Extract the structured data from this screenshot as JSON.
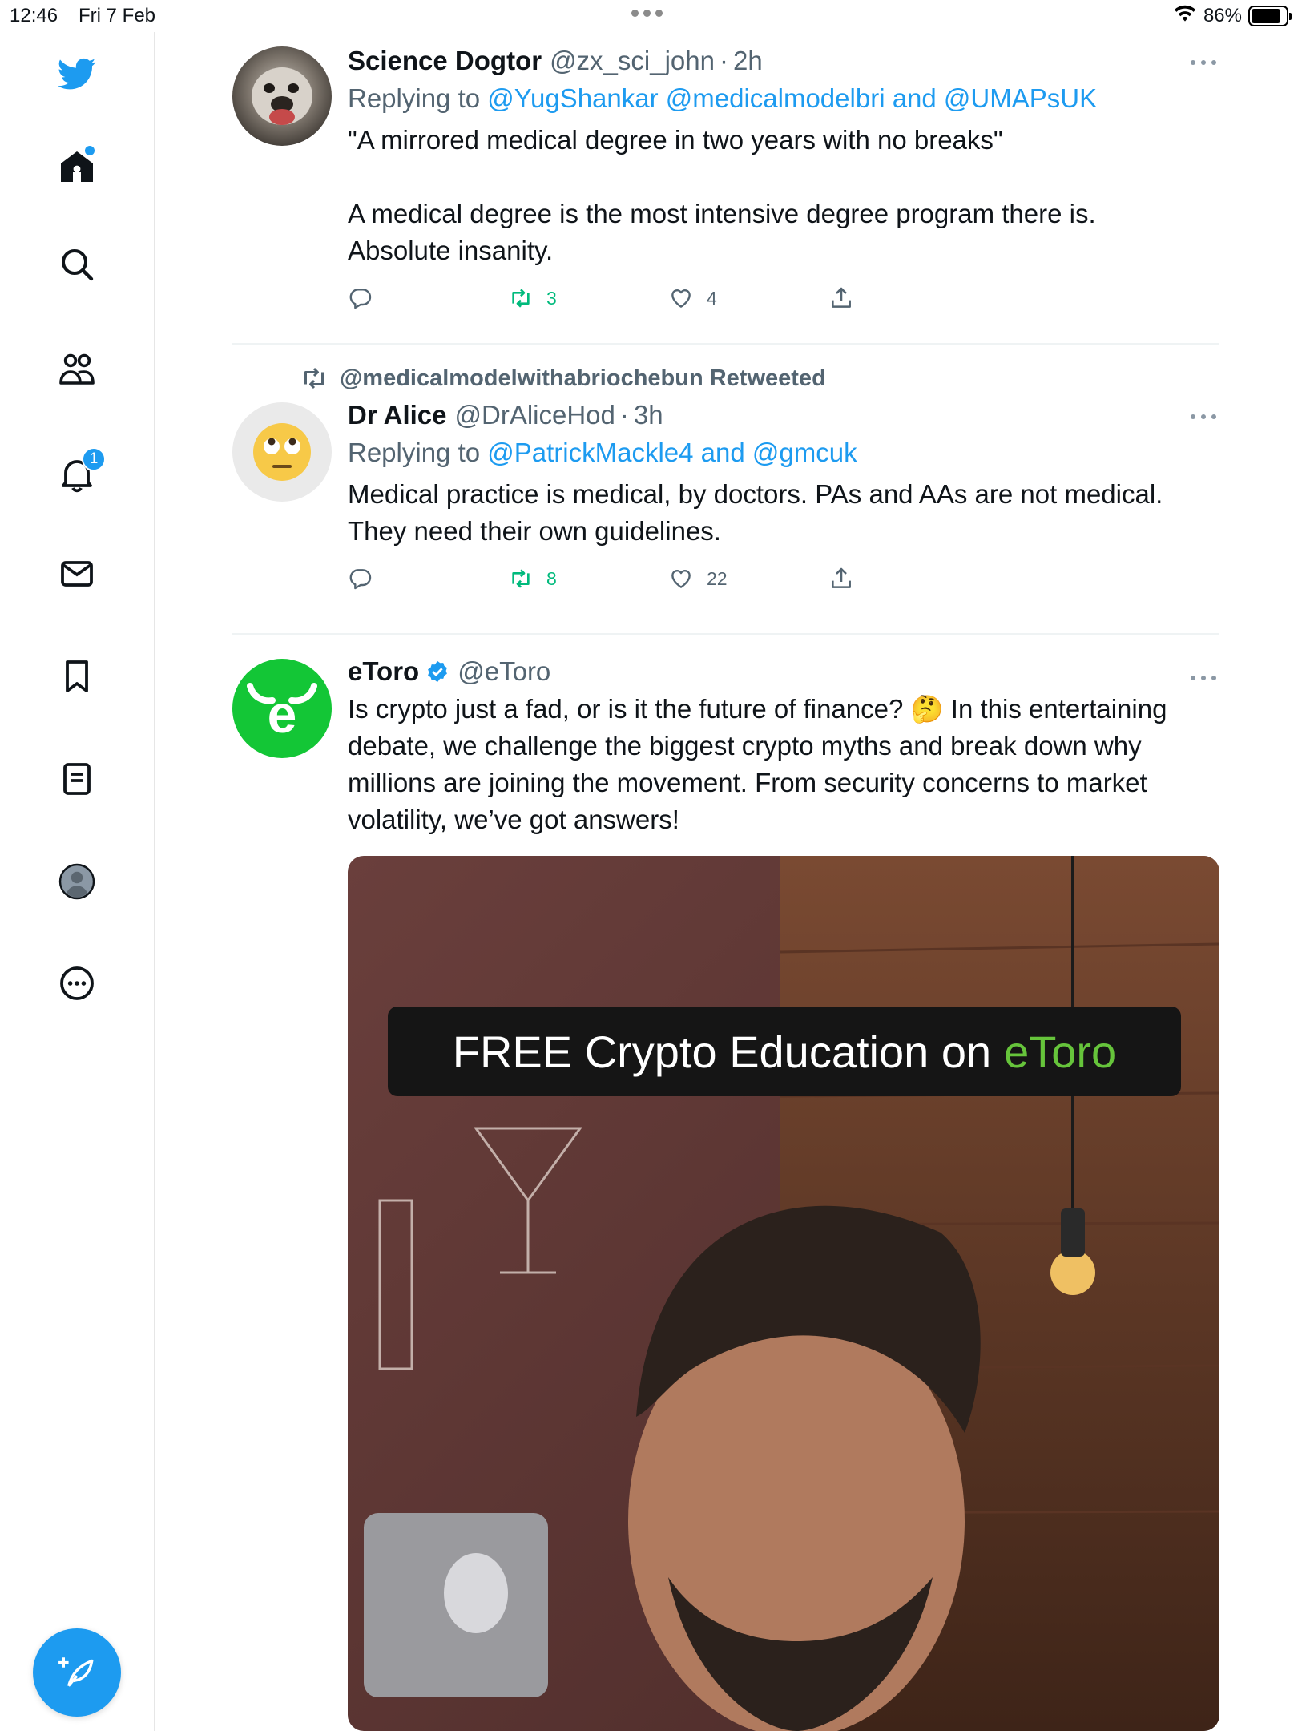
{
  "status_bar": {
    "time": "12:46",
    "date": "Fri 7 Feb",
    "battery": "86%",
    "battery_level": 0.86
  },
  "sidebar": {
    "items": [
      {
        "name": "twitter-logo-icon"
      },
      {
        "name": "home-icon",
        "has_dot": true
      },
      {
        "name": "search-icon"
      },
      {
        "name": "communities-icon"
      },
      {
        "name": "notifications-icon",
        "badge": "1"
      },
      {
        "name": "messages-icon"
      },
      {
        "name": "bookmarks-icon"
      },
      {
        "name": "lists-icon"
      },
      {
        "name": "profile-icon"
      },
      {
        "name": "more-icon"
      }
    ],
    "compose": {
      "name": "compose-tweet-icon"
    }
  },
  "colors": {
    "accent": "#1d9bf0",
    "retweet_green": "#00ba7c",
    "muted": "#536471",
    "etoro_green": "#13c636"
  },
  "tweets": [
    {
      "name": "Science Dogtor",
      "handle": "@zx_sci_john",
      "sep": "·",
      "time": "2h",
      "reply_prefix": "Replying to",
      "reply_mentions": "@YugShankar @medicalmodelbri and @UMAPsUK",
      "text_line1": "\"A mirrored medical degree in two years with no breaks\"",
      "text_line2": "A medical degree is the most intensive degree program there is.",
      "text_line3": "Absolute insanity.",
      "retweets": "3",
      "likes": "4",
      "retweeted_by_user": true
    },
    {
      "retweeted_label": "@medicalmodelwithabriochebun Retweeted",
      "name": "Dr Alice",
      "handle": "@DrAliceHod",
      "sep": "·",
      "time": "3h",
      "reply_prefix": "Replying to",
      "reply_mentions": "@PatrickMackle4 and @gmcuk",
      "text_line1": "Medical practice is medical, by doctors. PAs and AAs are not medical.",
      "text_line2": "They need their own guidelines.",
      "retweets": "8",
      "likes": "22",
      "retweeted_by_user": true
    },
    {
      "name": "eToro",
      "handle": "@eToro",
      "verified": true,
      "text_line1": "Is crypto just a fad, or is it the future of finance? 🤔 In this entertaining",
      "text_line2": "debate, we challenge the biggest crypto myths and break down why",
      "text_line3": "millions are joining the movement. From security concerns to market",
      "text_line4": "volatility, we’ve got answers!",
      "media_caption": "FREE Crypto Education on",
      "media_caption_brand": "eToro"
    }
  ]
}
